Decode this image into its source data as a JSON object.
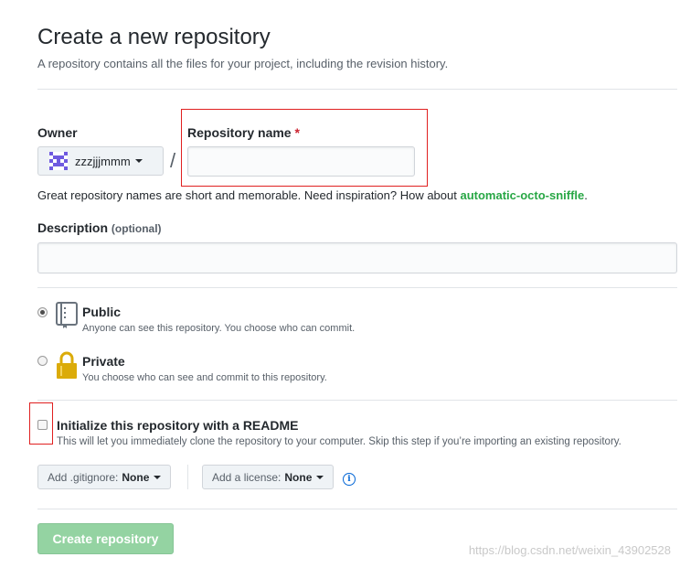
{
  "page": {
    "title": "Create a new repository",
    "subtitle": "A repository contains all the files for your project, including the revision history."
  },
  "owner": {
    "label": "Owner",
    "value": "zzzjjjmmm",
    "avatar_icon": "identicon"
  },
  "separator": "/",
  "repo_name": {
    "label": "Repository name",
    "required_mark": "*",
    "value": "",
    "placeholder": ""
  },
  "hint": {
    "text": "Great repository names are short and memorable. Need inspiration? How about ",
    "suggestion": "automatic-octo-sniffle",
    "end": "."
  },
  "description": {
    "label": "Description",
    "optional": "(optional)",
    "value": ""
  },
  "visibility": [
    {
      "title": "Public",
      "desc": "Anyone can see this repository. You choose who can commit.",
      "selected": true,
      "icon": "repo-book-icon"
    },
    {
      "title": "Private",
      "desc": "You choose who can see and commit to this repository.",
      "selected": false,
      "icon": "lock-icon"
    }
  ],
  "readme": {
    "title": "Initialize this repository with a README",
    "desc": "This will let you immediately clone the repository to your computer. Skip this step if you’re importing an existing repository.",
    "checked": false
  },
  "gitignore": {
    "label": "Add .gitignore:",
    "value": "None"
  },
  "license": {
    "label": "Add a license:",
    "value": "None"
  },
  "create_button": "Create repository",
  "watermark": "https://blog.csdn.net/weixin_43902528",
  "colors": {
    "accent_green": "#28a745",
    "create_button_bg": "#94d3a2",
    "highlight_red": "#e02020",
    "link_blue": "#0366d6"
  }
}
